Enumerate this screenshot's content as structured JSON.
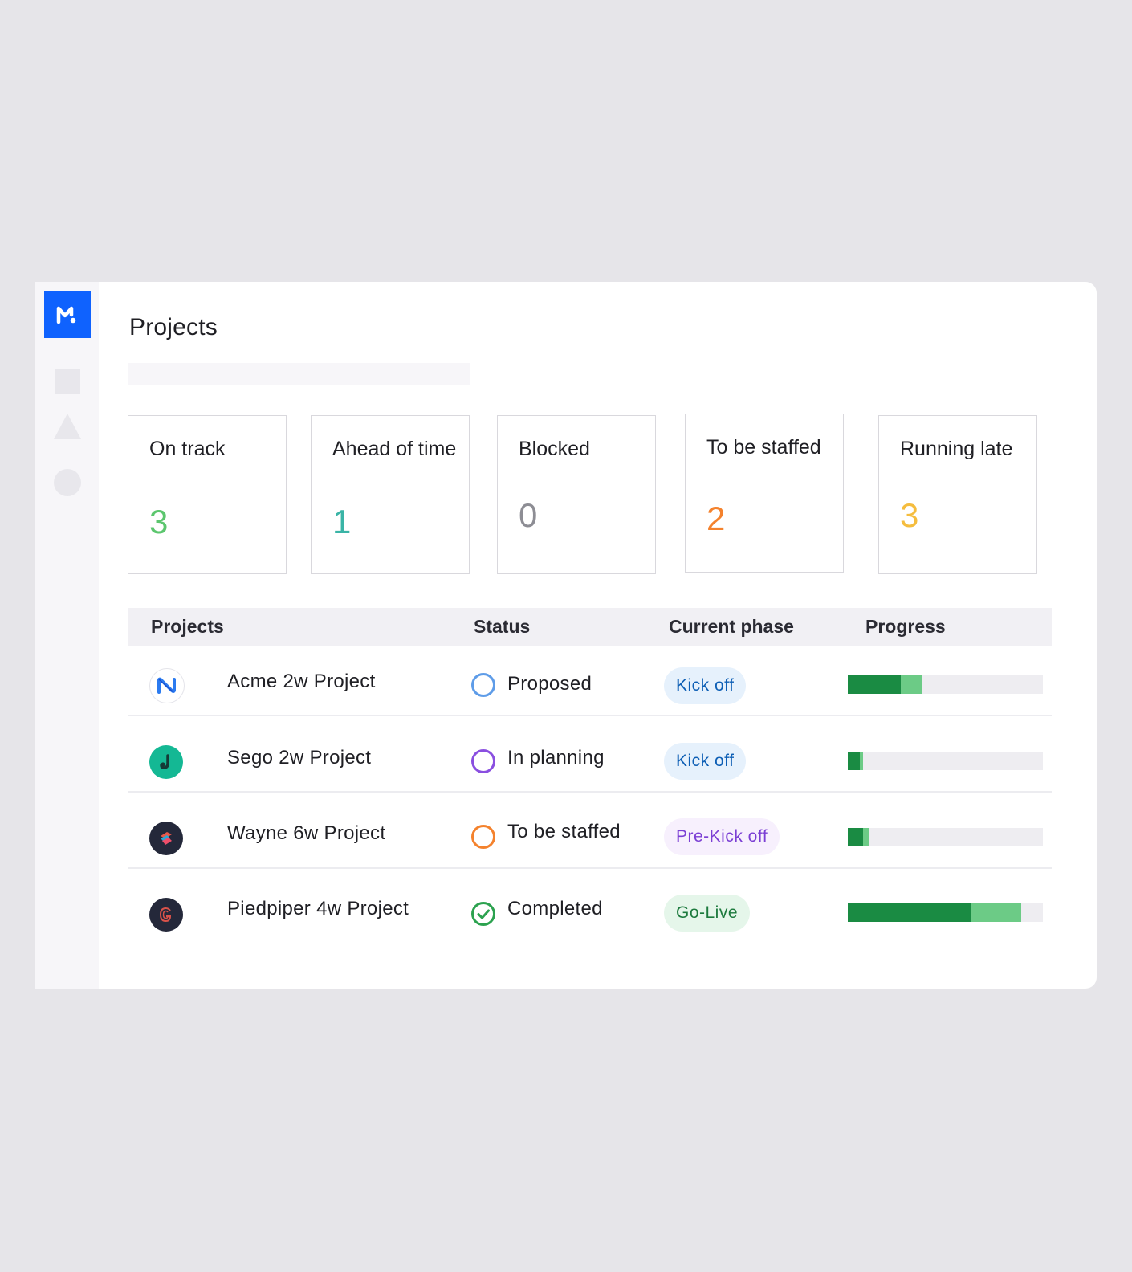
{
  "app": {
    "logo_icon": "m-logo-icon",
    "brand_color": "#0f62fe",
    "nav_icons": [
      "square-icon",
      "triangle-icon",
      "circle-icon"
    ]
  },
  "page": {
    "title": "Projects"
  },
  "summary_cards": [
    {
      "label": "On track",
      "value": "3",
      "color": "#5cc66e"
    },
    {
      "label": "Ahead of time",
      "value": "1",
      "color": "#3ab4a6"
    },
    {
      "label": "Blocked",
      "value": "0",
      "color": "#8d8d94"
    },
    {
      "label": "To be staffed",
      "value": "2",
      "color": "#f4822d"
    },
    {
      "label": "Running late",
      "value": "3",
      "color": "#f5bd3e"
    }
  ],
  "table": {
    "headers": {
      "projects": "Projects",
      "status": "Status",
      "phase": "Current phase",
      "progress": "Progress"
    },
    "rows": [
      {
        "avatar_icon": "acme-logo-icon",
        "name": "Acme 2w Project",
        "status": "Proposed",
        "status_color": "#5e9ce8",
        "phase": "Kick off",
        "phase_color": "#0e5fb5",
        "phase_bg": "#e6f1fc",
        "progress_dark": 0.27,
        "progress_light": 0.11
      },
      {
        "avatar_icon": "sego-logo-icon",
        "name": "Sego 2w Project",
        "status": "In planning",
        "status_color": "#8a4fe0",
        "phase": "Kick off",
        "phase_color": "#0e5fb5",
        "phase_bg": "#e6f1fc",
        "progress_dark": 0.06,
        "progress_light": 0.02
      },
      {
        "avatar_icon": "wayne-logo-icon",
        "name": "Wayne 6w Project",
        "status": "To be staffed",
        "status_color": "#f4822d",
        "phase": "Pre-Kick off",
        "phase_color": "#7b3fd4",
        "phase_bg": "#f7f0fd",
        "progress_dark": 0.08,
        "progress_light": 0.03
      },
      {
        "avatar_icon": "piedpiper-logo-icon",
        "name": "Piedpiper 4w Project",
        "status": "Completed",
        "status_color": "#2ca24f",
        "phase": "Go-Live",
        "phase_color": "#1c7a3d",
        "phase_bg": "#e5f6ea",
        "progress_dark": 0.63,
        "progress_light": 0.26
      }
    ]
  }
}
